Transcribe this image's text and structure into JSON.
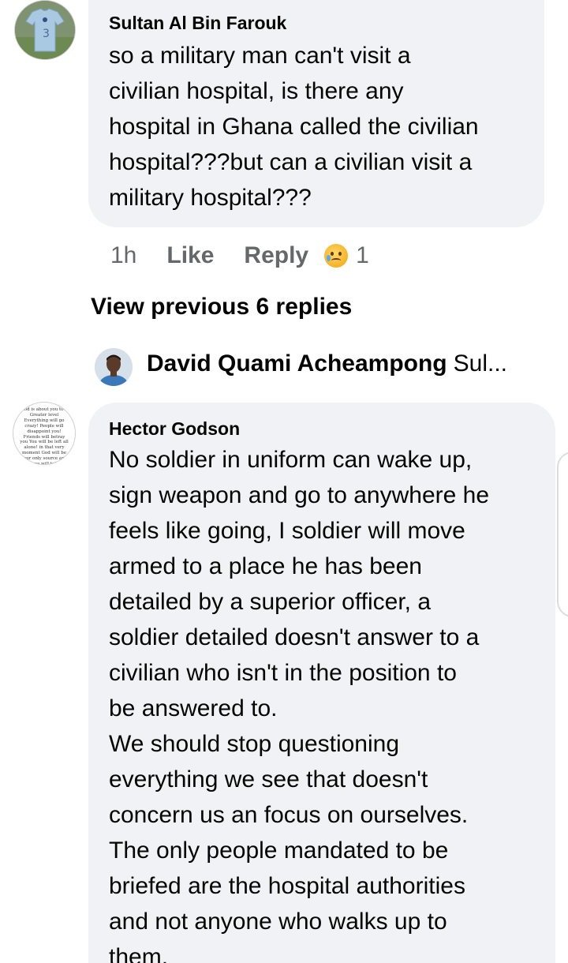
{
  "comment_1": {
    "author": "Sultan Al Bin Farouk",
    "text": "so a military man can't visit a\ncivilian hospital, is there any\nhospital in Ghana called the civilian\nhospital???but can a civilian visit a\nmilitary hospital???",
    "avatar_icon": "jersey-avatar-icon",
    "time": "1h",
    "like_label": "Like",
    "reply_label": "Reply",
    "reaction_icon": "sad-face-icon",
    "reaction_count": "1"
  },
  "view_previous": "View previous 6 replies",
  "reply_preview": {
    "author": "David Quami Acheampong",
    "snippet": "Sul...",
    "avatar_icon": "person-avatar-icon"
  },
  "comment_2": {
    "author": "Hector Godson",
    "avatar_text": "God is about you to a Greater level Everything will go crazy! People will disappoint you! Friends will betray you You will be left all alone! in that very moment God will be your only source and He alone will take the GLORY!!",
    "text": "No soldier in uniform can wake up,\nsign weapon and go to anywhere he\nfeels like going, I soldier will move\narmed to a place he has been\ndetailed by a superior officer, a\nsoldier detailed doesn't answer to a\ncivilian who isn't in the position to\nbe answered to.\nWe should stop questioning\neverything we see that doesn't\nconcern us an focus on ourselves.\nThe only people mandated to be\nbriefed are the hospital authorities\nand not anyone who walks up to\nthem."
  },
  "colors": {
    "bubble": "#f0f2f5",
    "secondary_text": "#65676b",
    "primary_text": "#050505"
  }
}
